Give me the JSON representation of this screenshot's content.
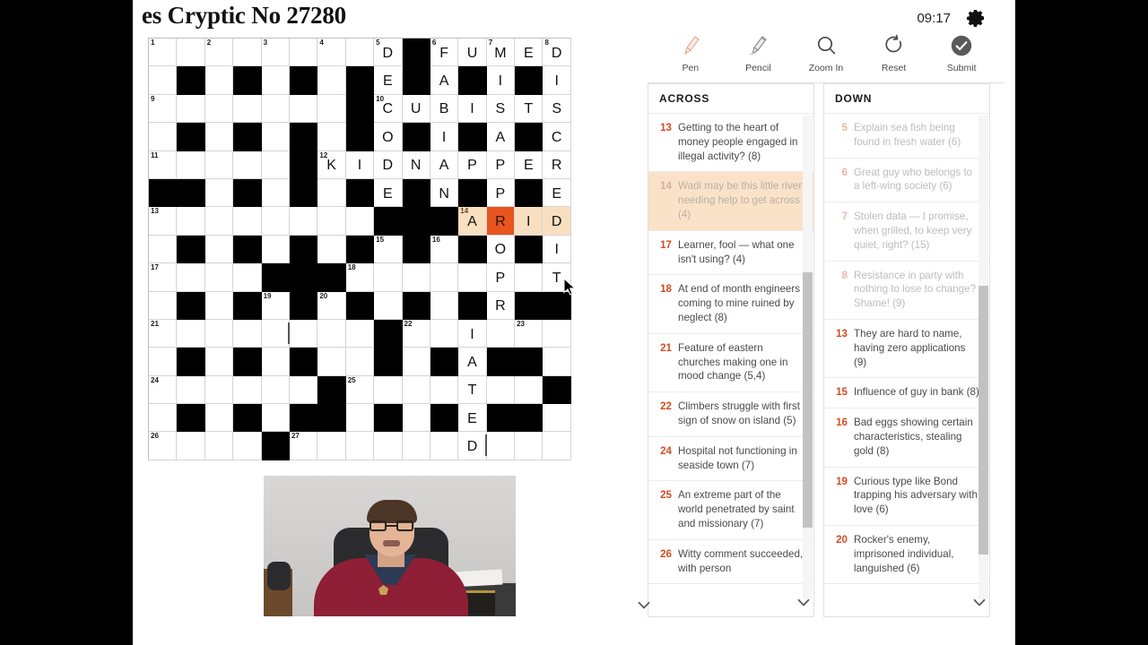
{
  "header": {
    "title": "es Cryptic No 27280",
    "timer": "09:17",
    "gear_icon": "gear-icon"
  },
  "toolbar": [
    {
      "label": "Pen",
      "icon": "pen-icon"
    },
    {
      "label": "Pencil",
      "icon": "pencil-icon"
    },
    {
      "label": "Zoom In",
      "icon": "magnifier-icon"
    },
    {
      "label": "Reset",
      "icon": "refresh-icon"
    },
    {
      "label": "Submit",
      "icon": "check-circle-icon"
    }
  ],
  "colors": {
    "accent": "#d24d22",
    "active_cell": "#e8551f",
    "highlight_word": "#f8dfc0",
    "clue_active_bg": "#f9e2c8",
    "solved_text": "#bdbdbd"
  },
  "across": {
    "heading": "ACROSS",
    "clues": [
      {
        "num": "13",
        "text": "Getting to the heart of money people engaged in illegal activity? (8)",
        "state": "normal"
      },
      {
        "num": "14",
        "text": "Wadi may be this little river needing help to get across (4)",
        "state": "active"
      },
      {
        "num": "17",
        "text": "Learner, fool — what one isn't using? (4)",
        "state": "normal"
      },
      {
        "num": "18",
        "text": "At end of month engineers coming to mine ruined by neglect (8)",
        "state": "normal"
      },
      {
        "num": "21",
        "text": "Feature of eastern churches making one in mood change (5,4)",
        "state": "normal"
      },
      {
        "num": "22",
        "text": "Climbers struggle with first sign of snow on island (5)",
        "state": "normal"
      },
      {
        "num": "24",
        "text": "Hospital not functioning in seaside town (7)",
        "state": "normal"
      },
      {
        "num": "25",
        "text": "An extreme part of the world penetrated by saint and missionary (7)",
        "state": "normal"
      },
      {
        "num": "26",
        "text": "Witty comment succeeded, with person",
        "state": "normal"
      }
    ]
  },
  "down": {
    "heading": "DOWN",
    "clues": [
      {
        "num": "5",
        "text": "Explain sea fish being found in fresh water (6)",
        "state": "solved"
      },
      {
        "num": "6",
        "text": "Great guy who belongs to a left-wing society (6)",
        "state": "solved"
      },
      {
        "num": "7",
        "text": "Stolen data — I promise, when grilled, to keep very quiet, right? (15)",
        "state": "solved"
      },
      {
        "num": "8",
        "text": "Resistance in party with nothing to lose to change? Shame! (9)",
        "state": "solved"
      },
      {
        "num": "13",
        "text": "They are hard to name, having zero applications (9)",
        "state": "normal"
      },
      {
        "num": "15",
        "text": "Influence of guy in bank (8)",
        "state": "normal"
      },
      {
        "num": "16",
        "text": "Bad eggs showing certain characteristics, stealing gold (8)",
        "state": "normal"
      },
      {
        "num": "19",
        "text": "Curious type like Bond trapping his adversary with love (6)",
        "state": "normal"
      },
      {
        "num": "20",
        "text": "Rocker's enemy, imprisoned individual, languished (6)",
        "state": "normal"
      }
    ]
  },
  "grid": {
    "size": 15,
    "rows": [
      [
        {
          "t": "w",
          "n": "1"
        },
        {
          "t": "w"
        },
        {
          "t": "w",
          "n": "2"
        },
        {
          "t": "w"
        },
        {
          "t": "w",
          "n": "3"
        },
        {
          "t": "w"
        },
        {
          "t": "w",
          "n": "4"
        },
        {
          "t": "w"
        },
        {
          "t": "w",
          "n": "5",
          "l": "D"
        },
        {
          "t": "b"
        },
        {
          "t": "w",
          "n": "6",
          "l": "F"
        },
        {
          "t": "w",
          "l": "U"
        },
        {
          "t": "w",
          "n": "7",
          "l": "M"
        },
        {
          "t": "w",
          "l": "E"
        },
        {
          "t": "w",
          "n": "8",
          "l": "D"
        }
      ],
      [
        {
          "t": "w"
        },
        {
          "t": "b"
        },
        {
          "t": "w"
        },
        {
          "t": "b"
        },
        {
          "t": "w"
        },
        {
          "t": "b"
        },
        {
          "t": "w"
        },
        {
          "t": "b"
        },
        {
          "t": "w",
          "l": "E"
        },
        {
          "t": "b"
        },
        {
          "t": "w",
          "l": "A"
        },
        {
          "t": "b"
        },
        {
          "t": "w",
          "l": "I"
        },
        {
          "t": "b"
        },
        {
          "t": "w",
          "l": "I"
        }
      ],
      [
        {
          "t": "w",
          "n": "9"
        },
        {
          "t": "w"
        },
        {
          "t": "w"
        },
        {
          "t": "w"
        },
        {
          "t": "w"
        },
        {
          "t": "w"
        },
        {
          "t": "w"
        },
        {
          "t": "b"
        },
        {
          "t": "w",
          "n": "10",
          "l": "C"
        },
        {
          "t": "w",
          "l": "U"
        },
        {
          "t": "w",
          "l": "B"
        },
        {
          "t": "w",
          "l": "I"
        },
        {
          "t": "w",
          "l": "S"
        },
        {
          "t": "w",
          "l": "T"
        },
        {
          "t": "w",
          "l": "S"
        }
      ],
      [
        {
          "t": "w"
        },
        {
          "t": "b"
        },
        {
          "t": "w"
        },
        {
          "t": "b"
        },
        {
          "t": "w"
        },
        {
          "t": "b"
        },
        {
          "t": "w"
        },
        {
          "t": "b"
        },
        {
          "t": "w",
          "l": "O"
        },
        {
          "t": "b"
        },
        {
          "t": "w",
          "l": "I"
        },
        {
          "t": "b"
        },
        {
          "t": "w",
          "l": "A"
        },
        {
          "t": "b"
        },
        {
          "t": "w",
          "l": "C"
        }
      ],
      [
        {
          "t": "w",
          "n": "11"
        },
        {
          "t": "w"
        },
        {
          "t": "w"
        },
        {
          "t": "w"
        },
        {
          "t": "w"
        },
        {
          "t": "b"
        },
        {
          "t": "w",
          "n": "12",
          "l": "K"
        },
        {
          "t": "w",
          "l": "I"
        },
        {
          "t": "w",
          "l": "D"
        },
        {
          "t": "w",
          "l": "N"
        },
        {
          "t": "w",
          "l": "A"
        },
        {
          "t": "w",
          "l": "P"
        },
        {
          "t": "w",
          "l": "P"
        },
        {
          "t": "w",
          "l": "E"
        },
        {
          "t": "w",
          "l": "R"
        }
      ],
      [
        {
          "t": "b"
        },
        {
          "t": "b"
        },
        {
          "t": "w"
        },
        {
          "t": "b"
        },
        {
          "t": "w"
        },
        {
          "t": "b"
        },
        {
          "t": "w"
        },
        {
          "t": "b"
        },
        {
          "t": "w",
          "l": "E"
        },
        {
          "t": "b"
        },
        {
          "t": "w",
          "l": "N"
        },
        {
          "t": "b"
        },
        {
          "t": "w",
          "l": "P"
        },
        {
          "t": "b"
        },
        {
          "t": "w",
          "l": "E"
        }
      ],
      [
        {
          "t": "w",
          "n": "13"
        },
        {
          "t": "w"
        },
        {
          "t": "w"
        },
        {
          "t": "w"
        },
        {
          "t": "w"
        },
        {
          "t": "w"
        },
        {
          "t": "w"
        },
        {
          "t": "w"
        },
        {
          "t": "b"
        },
        {
          "t": "b"
        },
        {
          "t": "b"
        },
        {
          "t": "h",
          "n": "14",
          "l": "A"
        },
        {
          "t": "a",
          "l": "R"
        },
        {
          "t": "h",
          "l": "I"
        },
        {
          "t": "h",
          "l": "D"
        }
      ],
      [
        {
          "t": "w"
        },
        {
          "t": "b"
        },
        {
          "t": "w"
        },
        {
          "t": "b"
        },
        {
          "t": "w"
        },
        {
          "t": "b"
        },
        {
          "t": "w"
        },
        {
          "t": "b"
        },
        {
          "t": "w",
          "n": "15"
        },
        {
          "t": "b"
        },
        {
          "t": "w",
          "n": "16"
        },
        {
          "t": "b"
        },
        {
          "t": "w",
          "l": "O"
        },
        {
          "t": "b"
        },
        {
          "t": "w",
          "l": "I"
        }
      ],
      [
        {
          "t": "w",
          "n": "17"
        },
        {
          "t": "w"
        },
        {
          "t": "w"
        },
        {
          "t": "w"
        },
        {
          "t": "b"
        },
        {
          "t": "b"
        },
        {
          "t": "b"
        },
        {
          "t": "w",
          "n": "18"
        },
        {
          "t": "w"
        },
        {
          "t": "w"
        },
        {
          "t": "w"
        },
        {
          "t": "w"
        },
        {
          "t": "w",
          "l": "P"
        },
        {
          "t": "w"
        },
        {
          "t": "w",
          "l": "T"
        }
      ],
      [
        {
          "t": "w"
        },
        {
          "t": "b"
        },
        {
          "t": "w"
        },
        {
          "t": "b"
        },
        {
          "t": "w",
          "n": "19"
        },
        {
          "t": "b"
        },
        {
          "t": "w",
          "n": "20"
        },
        {
          "t": "b"
        },
        {
          "t": "w"
        },
        {
          "t": "b"
        },
        {
          "t": "w"
        },
        {
          "t": "b"
        },
        {
          "t": "w",
          "l": "R"
        },
        {
          "t": "b"
        },
        {
          "t": "b"
        }
      ],
      [
        {
          "t": "w",
          "n": "21"
        },
        {
          "t": "w"
        },
        {
          "t": "w"
        },
        {
          "t": "w"
        },
        {
          "t": "w"
        },
        {
          "t": "w"
        },
        {
          "t": "w"
        },
        {
          "t": "w"
        },
        {
          "t": "b"
        },
        {
          "t": "w",
          "n": "22"
        },
        {
          "t": "w"
        },
        {
          "t": "w",
          "l": "I"
        },
        {
          "t": "w"
        },
        {
          "t": "w",
          "n": "23"
        },
        {
          "t": "w"
        }
      ],
      [
        {
          "t": "w"
        },
        {
          "t": "b"
        },
        {
          "t": "w"
        },
        {
          "t": "b"
        },
        {
          "t": "w"
        },
        {
          "t": "b"
        },
        {
          "t": "w"
        },
        {
          "t": "w"
        },
        {
          "t": "b"
        },
        {
          "t": "w"
        },
        {
          "t": "b"
        },
        {
          "t": "w",
          "l": "A"
        },
        {
          "t": "b"
        },
        {
          "t": "b"
        },
        {
          "t": "w"
        }
      ],
      [
        {
          "t": "w",
          "n": "24"
        },
        {
          "t": "w"
        },
        {
          "t": "w"
        },
        {
          "t": "w"
        },
        {
          "t": "w"
        },
        {
          "t": "w"
        },
        {
          "t": "b"
        },
        {
          "t": "w",
          "n": "25"
        },
        {
          "t": "w"
        },
        {
          "t": "w"
        },
        {
          "t": "w"
        },
        {
          "t": "w",
          "l": "T"
        },
        {
          "t": "w"
        },
        {
          "t": "w"
        },
        {
          "t": "b"
        }
      ],
      [
        {
          "t": "w"
        },
        {
          "t": "b"
        },
        {
          "t": "w"
        },
        {
          "t": "b"
        },
        {
          "t": "w"
        },
        {
          "t": "b"
        },
        {
          "t": "b"
        },
        {
          "t": "w"
        },
        {
          "t": "b"
        },
        {
          "t": "w"
        },
        {
          "t": "b"
        },
        {
          "t": "w",
          "l": "E"
        },
        {
          "t": "b"
        },
        {
          "t": "b"
        },
        {
          "t": "w"
        }
      ],
      [
        {
          "t": "w",
          "n": "26"
        },
        {
          "t": "w"
        },
        {
          "t": "w"
        },
        {
          "t": "w"
        },
        {
          "t": "b"
        },
        {
          "t": "w",
          "n": "27"
        },
        {
          "t": "w"
        },
        {
          "t": "w"
        },
        {
          "t": "w"
        },
        {
          "t": "w"
        },
        {
          "t": "w"
        },
        {
          "t": "w",
          "l": "D"
        },
        {
          "t": "w"
        },
        {
          "t": "w"
        },
        {
          "t": "w"
        }
      ]
    ]
  },
  "video": {
    "label": "webcam-video-overlay"
  }
}
